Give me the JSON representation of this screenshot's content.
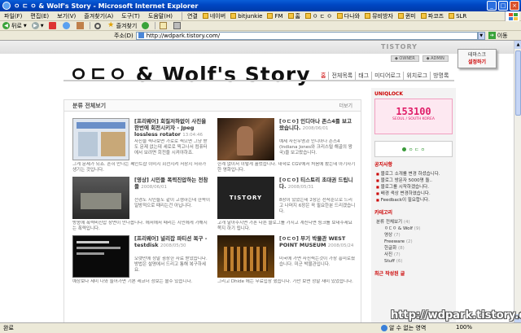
{
  "window": {
    "title": "ㅇ ㄷ ㅇ & Wolf's Story - Microsoft Internet Explorer",
    "min": "_",
    "max": "□",
    "close": "×"
  },
  "menu": [
    "파일(F)",
    "편집(E)",
    "보기(V)",
    "즐겨찾기(A)",
    "도구(T)",
    "도움말(H)"
  ],
  "links": [
    "연결",
    "네이버",
    "bitjunkie",
    "FM",
    "홈",
    "ㅇ ㄷ ㅇ",
    "다나와",
    "뮤비방자",
    "퀸미",
    "파코즈",
    "SLR"
  ],
  "toolbar": {
    "back": "뒤로",
    "favorites": "즐겨찾기"
  },
  "address": {
    "label": "주소(D)",
    "url": "http://wdpark.tistory.com/",
    "go": "이동"
  },
  "blog": {
    "tistory_logo": "TISTORY",
    "tistory_btn1": "◆ OWNER",
    "tistory_btn2": "◆ ADMIN",
    "admin_line1": "테마스크",
    "admin_line2": "설정하기",
    "title": "ㅇㄷㅇ & Wolf's Story",
    "nav_home": "홈",
    "nav": [
      "전체목록",
      "태그",
      "미디어로그",
      "위치로그",
      "방명록"
    ],
    "panel_title": "분류 전체보기",
    "panel_more": "더보기"
  },
  "posts": [
    {
      "title": "[프리웨어] 회질저하없이 사진을 한번에 회전시키자 - Jpeg lossless rotator",
      "date": "13:04:46",
      "body": "사진을 찍다보면 가로로 찍으면 그냥 받도 문제 없는데 세로로 찍고나서 컴퓨터에서 보려면 회전을 시켜야하죠.",
      "more": "그게 문제가 되죠. 흔히 만나는 페인트샵 이미지 회전시켜 저장시 저하가 생기는 것입니다."
    },
    {
      "title": "[ㅇㄷㅇ] 인디아나 존스4를 보고왔습니다.",
      "date": "2008/06/01",
      "body": "예제 사진우영과 인디아나 존스4 (Indiana Jones와 크리스털 해골의 왕국)을 보고왔습니다.",
      "more": "한계 없이서 이렇게 흘렀습니다. 대학로 CGV에서 처음에 봤는데 아기자기한 영화입니다."
    },
    {
      "title": "[영상] 시민들 폭력진압하는 전참들",
      "date": "2008/06/01",
      "body": "전경도 시민들도 같이 고생하는데 한쪽이 일방적으로 때리는건 아닙니다.",
      "more": "방송에 폭력비진압 장면이 안나옵니다. 에서에서 때리는 시민에게 가해지는 폭력입니다."
    },
    {
      "title": "[ㅇㄷㅇ] 티스토리 초대권 드립니다.",
      "date": "2008/05/31",
      "body": "8장이 있었는데 2장은 선착순으로 드리고 나머지 6장은 꼭 필요한분 드리겠습니다.",
      "more": "고개 달아주시면 가혼 다른 블로그를 가지고 계신다면 링크를 보내주세요 쪽지 하기 됩니다."
    },
    {
      "title": "[프리웨어] 널리잡 파티션 복구 - testdisk",
      "date": "2008/05/30",
      "body": "오랫만에 정말 굉장한 자료 받았습니다. 방법은 설명에서 드리고 통해 복구하세요.",
      "more": "예상보다 세미 나와 들어가면 기본 레코더 정보는 볼수 있습니다."
    },
    {
      "title": "[ㅇㄷㅇ] 부기 박물관 WEST POINT MUSEUM",
      "date": "2008/05/24",
      "body": "미국에 가면 사진찍는것이 가장 흥미로웠습니다. 미군 박물관입니다.",
      "more": "그리고 Dhide 에는 무료입장 했습니다. 가만 보면 정말 재미 있었습니다."
    }
  ],
  "sidebar": {
    "counter_head": "UNIQLOCK",
    "counter_value": "153100",
    "counter_sub": "SEOUL / SOUTH KOREA",
    "banner": "ㅇ ㄷ ㅇ",
    "notice_head": "공지사항",
    "notices": [
      "블로그 소개를 변경 하셨습니다.",
      "블로그 방문자 5000명 돌..",
      "블로그를 시작하겠습니다.",
      "배경 색상 변경하였습니다.",
      "Feedback이 필요합니다."
    ],
    "category_head": "카테고리",
    "categories": [
      {
        "name": "분류 전체보기",
        "count": "(4)"
      },
      {
        "name": "ㅇㄷㅇ & Wolf",
        "count": "(9)"
      },
      {
        "name": "영상",
        "count": "(7)"
      },
      {
        "name": "Freeware",
        "count": "(2)"
      },
      {
        "name": "한글화",
        "count": "(8)"
      },
      {
        "name": "사진",
        "count": "(7)"
      },
      {
        "name": "Stuff",
        "count": "(6)"
      }
    ],
    "recent_head": "최근 작성된 글"
  },
  "statusbar": {
    "text": "완료",
    "zone": "알 수 없는 영역",
    "zoom": "100%"
  },
  "watermark": "http://wdpark.tistory.com"
}
